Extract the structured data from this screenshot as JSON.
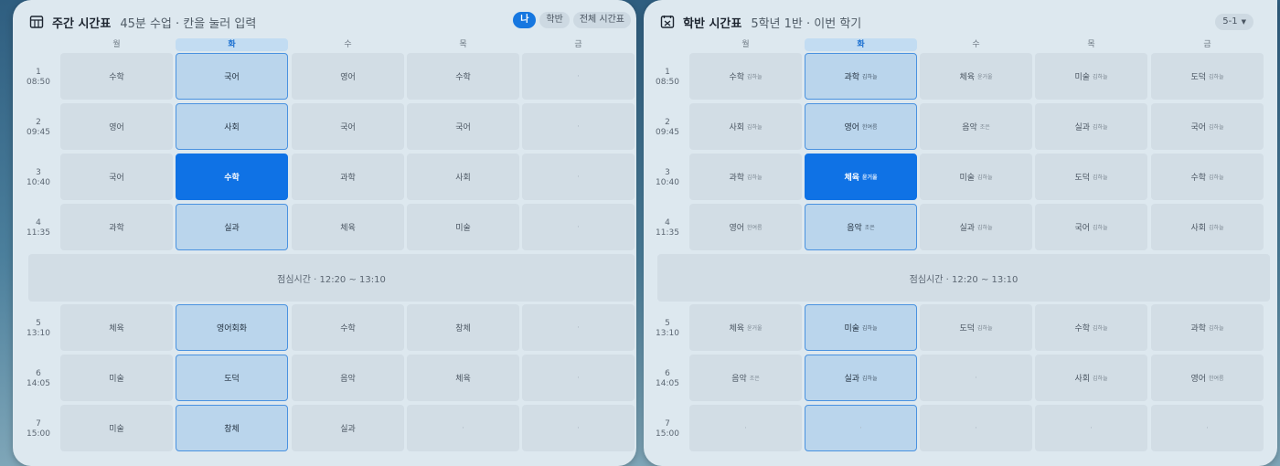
{
  "left": {
    "title": "주간 시간표",
    "subtitle": "45분 수업 · 칸을 눌러 입력",
    "view_buttons": [
      {
        "label": "나",
        "active": true
      },
      {
        "label": "학반",
        "active": false
      },
      {
        "label": "전체 시간표",
        "active": false
      }
    ],
    "days": [
      "월",
      "화",
      "수",
      "목",
      "금"
    ],
    "today_index": 1,
    "lunch": "점심시간 · 12:20 ~ 13:10",
    "periods": [
      {
        "no": "1",
        "time": "08:50",
        "cells": [
          {
            "s": "수학"
          },
          {
            "s": "국어"
          },
          {
            "s": "영어"
          },
          {
            "s": "수학"
          },
          {
            "s": "·"
          }
        ]
      },
      {
        "no": "2",
        "time": "09:45",
        "cells": [
          {
            "s": "영어"
          },
          {
            "s": "사회"
          },
          {
            "s": "국어"
          },
          {
            "s": "국어"
          },
          {
            "s": "·"
          }
        ]
      },
      {
        "no": "3",
        "time": "10:40",
        "cells": [
          {
            "s": "국어"
          },
          {
            "s": "수학",
            "sel": true
          },
          {
            "s": "과학"
          },
          {
            "s": "사회"
          },
          {
            "s": "·"
          }
        ]
      },
      {
        "no": "4",
        "time": "11:35",
        "cells": [
          {
            "s": "과학"
          },
          {
            "s": "실과"
          },
          {
            "s": "체육"
          },
          {
            "s": "미술"
          },
          {
            "s": "·"
          }
        ]
      },
      {
        "no": "5",
        "time": "13:10",
        "cells": [
          {
            "s": "체육"
          },
          {
            "s": "영어회화"
          },
          {
            "s": "수학"
          },
          {
            "s": "창체"
          },
          {
            "s": "·"
          }
        ]
      },
      {
        "no": "6",
        "time": "14:05",
        "cells": [
          {
            "s": "미술"
          },
          {
            "s": "도덕"
          },
          {
            "s": "음악"
          },
          {
            "s": "체육"
          },
          {
            "s": "·"
          }
        ]
      },
      {
        "no": "7",
        "time": "15:00",
        "cells": [
          {
            "s": "미술"
          },
          {
            "s": "창체"
          },
          {
            "s": "실과"
          },
          {
            "s": "·"
          },
          {
            "s": "·"
          }
        ]
      }
    ]
  },
  "right": {
    "title": "학반 시간표",
    "subtitle": "5학년 1반 · 이번 학기",
    "class_select": "5-1",
    "days": [
      "월",
      "화",
      "수",
      "목",
      "금"
    ],
    "today_index": 1,
    "lunch": "점심시간 · 12:20 ~ 13:10",
    "periods": [
      {
        "no": "1",
        "time": "08:50",
        "cells": [
          {
            "s": "수학",
            "t": "김하늘"
          },
          {
            "s": "과학",
            "t": "김하늘"
          },
          {
            "s": "체육",
            "t": "윤거울"
          },
          {
            "s": "미술",
            "t": "김하늘"
          },
          {
            "s": "도덕",
            "t": "김하늘"
          }
        ]
      },
      {
        "no": "2",
        "time": "09:45",
        "cells": [
          {
            "s": "사회",
            "t": "김하늘"
          },
          {
            "s": "영어",
            "t": "한여름"
          },
          {
            "s": "음악",
            "t": "조은"
          },
          {
            "s": "실과",
            "t": "김하늘"
          },
          {
            "s": "국어",
            "t": "김하늘"
          }
        ]
      },
      {
        "no": "3",
        "time": "10:40",
        "cells": [
          {
            "s": "과학",
            "t": "김하늘"
          },
          {
            "s": "체육",
            "t": "윤거울",
            "sel": true
          },
          {
            "s": "미술",
            "t": "김하늘"
          },
          {
            "s": "도덕",
            "t": "김하늘"
          },
          {
            "s": "수학",
            "t": "김하늘"
          }
        ]
      },
      {
        "no": "4",
        "time": "11:35",
        "cells": [
          {
            "s": "영어",
            "t": "한여름"
          },
          {
            "s": "음악",
            "t": "조은"
          },
          {
            "s": "실과",
            "t": "김하늘"
          },
          {
            "s": "국어",
            "t": "김하늘"
          },
          {
            "s": "사회",
            "t": "김하늘"
          }
        ]
      },
      {
        "no": "5",
        "time": "13:10",
        "cells": [
          {
            "s": "체육",
            "t": "윤거울"
          },
          {
            "s": "미술",
            "t": "김하늘"
          },
          {
            "s": "도덕",
            "t": "김하늘"
          },
          {
            "s": "수학",
            "t": "김하늘"
          },
          {
            "s": "과학",
            "t": "김하늘"
          }
        ]
      },
      {
        "no": "6",
        "time": "14:05",
        "cells": [
          {
            "s": "음악",
            "t": "조은"
          },
          {
            "s": "실과",
            "t": "김하늘"
          },
          {
            "s": "·"
          },
          {
            "s": "사회",
            "t": "김하늘"
          },
          {
            "s": "영어",
            "t": "한여름"
          }
        ]
      },
      {
        "no": "7",
        "time": "15:00",
        "cells": [
          {
            "s": "·"
          },
          {
            "s": "·"
          },
          {
            "s": "·"
          },
          {
            "s": "·"
          },
          {
            "s": "·"
          }
        ]
      }
    ]
  },
  "icons": {
    "left_header": "calendar-grid-icon",
    "right_header": "class-calendar-icon",
    "dropdown": "chevron-down-icon"
  },
  "colors": {
    "accent": "#0f72e5",
    "today_fill": "#bad5ec",
    "today_border": "#4a92e0",
    "cell": "#d2dde5",
    "panel": "#dde8ef"
  }
}
